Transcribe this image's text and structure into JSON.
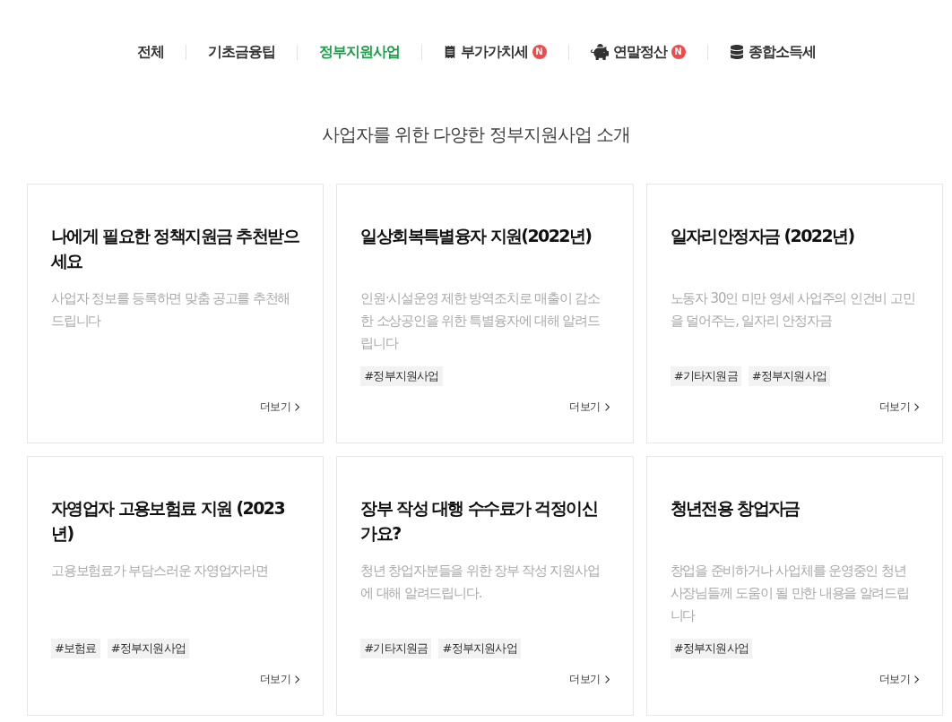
{
  "tabs": [
    {
      "label": "전체",
      "kind": "text",
      "selected": false
    },
    {
      "label": "기초금융팁",
      "kind": "text",
      "selected": false
    },
    {
      "label": "정부지원사업",
      "kind": "text",
      "selected": true
    },
    {
      "label": "부가가치세",
      "kind": "receipt",
      "badge": "N",
      "selected": false
    },
    {
      "label": "연말정산",
      "kind": "piggy-bank",
      "badge": "N",
      "selected": false
    },
    {
      "label": "종합소득세",
      "kind": "database",
      "selected": false
    }
  ],
  "heading": "사업자를 위한 다양한 정부지원사업 소개",
  "cards": [
    {
      "title": "나에게 필요한 정책지원금 추천받으세요",
      "description": "사업자 정보를 등록하면 맞춤 공고를 추천해드립니다",
      "more": "더보기"
    },
    {
      "title": "일상회복특별융자 지원(2022년)",
      "description": "인원·시설운영 제한 방역조치로 매출이 감소한 소상공인을 위한 특별융자에 대해 알려드립니다",
      "tags": [
        "#정부지원사업"
      ],
      "more": "더보기"
    },
    {
      "title": "일자리안정자금 (2022년)",
      "description": "노동자 30인 미만 영세 사업주의 인건비 고민을 덜어주는, 일자리 안정자금",
      "tags": [
        "#기타지원금",
        "#정부지원사업"
      ],
      "more": "더보기"
    },
    {
      "title": "자영업자 고용보험료 지원 (2023년)",
      "description": "고용보험료가 부담스러운 자영업자라면",
      "tags": [
        "#보험료",
        "#정부지원사업"
      ],
      "more": "더보기"
    },
    {
      "title": "장부 작성 대행 수수료가 걱정이신가요?",
      "description": "청년 창업자분들을 위한 장부 작성 지원사업에 대해 알려드립니다.",
      "tags": [
        "#기타지원금",
        "#정부지원사업"
      ],
      "more": "더보기"
    },
    {
      "title": "청년전용 창업자금",
      "description": "창업을 준비하거나 사업체를 운영중인 청년 사장님들께 도움이 될 만한 내용을 알려드립니다",
      "tags": [
        "#정부지원사업"
      ],
      "more": "더보기"
    }
  ]
}
